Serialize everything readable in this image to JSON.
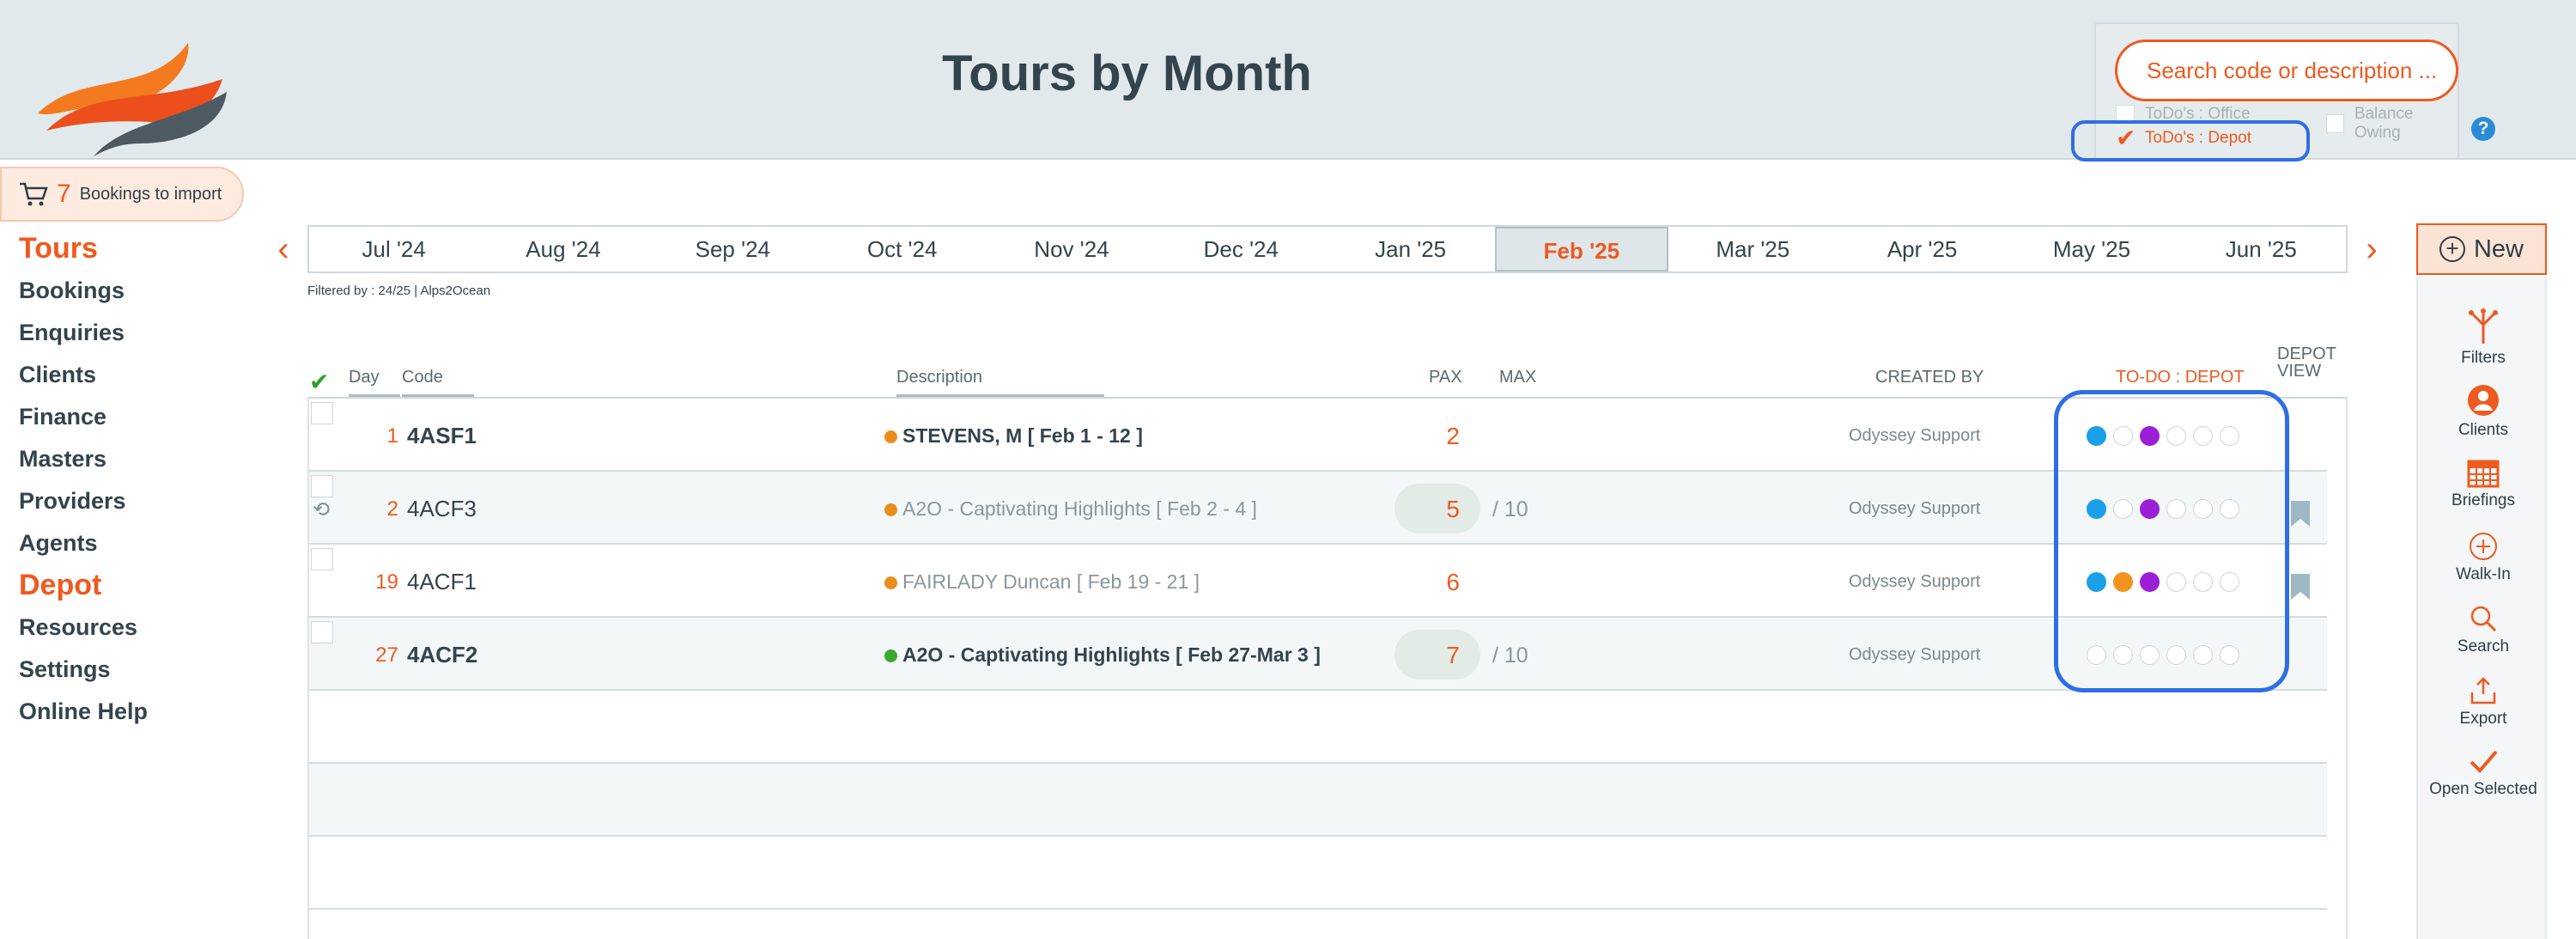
{
  "header": {
    "title": "Tours by Month"
  },
  "search": {
    "placeholder": "Search code or description ...",
    "todo_office_label": "ToDo's : Office",
    "balance_owing_label": "Balance Owing",
    "todo_depot_label": "ToDo's : Depot",
    "todo_depot_checked": true,
    "help": "?"
  },
  "import": {
    "count": "7",
    "label": "Bookings to import"
  },
  "sidebar": {
    "items": [
      {
        "label": "Tours",
        "section": true
      },
      {
        "label": "Bookings"
      },
      {
        "label": "Enquiries"
      },
      {
        "label": "Clients"
      },
      {
        "label": "Finance"
      },
      {
        "label": "Masters"
      },
      {
        "label": "Providers"
      },
      {
        "label": "Agents"
      },
      {
        "label": "Depot",
        "section": true
      },
      {
        "label": "Resources"
      },
      {
        "label": "Settings"
      },
      {
        "label": "Online Help"
      }
    ]
  },
  "months": {
    "tabs": [
      "Jul '24",
      "Aug '24",
      "Sep '24",
      "Oct '24",
      "Nov '24",
      "Dec '24",
      "Jan '25",
      "Feb '25",
      "Mar '25",
      "Apr '25",
      "May '25",
      "Jun '25"
    ],
    "active": "Feb '25",
    "prev_icon": "chevron-left-icon",
    "next_icon": "chevron-right-icon"
  },
  "filter_note": "Filtered by : 24/25 | Alps2Ocean",
  "table": {
    "headers": {
      "day": "Day",
      "code": "Code",
      "description": "Description",
      "pax": "PAX",
      "max": "MAX",
      "created_by": "CREATED BY",
      "todo": "TO-DO : DEPOT",
      "depot_view_1": "DEPOT",
      "depot_view_2": "VIEW"
    },
    "rows": [
      {
        "day": "1",
        "code": "4ASF1",
        "bold": true,
        "dot_color": "#e98d1c",
        "description": "STEVENS, M  [ Feb 1 - 12 ]",
        "pax": "2",
        "max": "",
        "created_by": "Odyssey Support",
        "todos": [
          "blue",
          "",
          "purple",
          "",
          "",
          ""
        ],
        "bookmark": false,
        "history": false
      },
      {
        "day": "2",
        "code": "4ACF3",
        "bold": false,
        "dot_color": "#e98d1c",
        "description": "A2O - Captivating Highlights  [ Feb 2 - 4 ]",
        "pax": "5",
        "max": "/ 10",
        "created_by": "Odyssey Support",
        "todos": [
          "blue",
          "",
          "purple",
          "",
          "",
          ""
        ],
        "bookmark": true,
        "history": true
      },
      {
        "day": "19",
        "code": "4ACF1",
        "bold": false,
        "dot_color": "#e98d1c",
        "description": "FAIRLADY Duncan  [ Feb 19 - 21 ]",
        "pax": "6",
        "max": "",
        "created_by": "Odyssey Support",
        "todos": [
          "blue",
          "orange",
          "purple",
          "",
          "",
          ""
        ],
        "bookmark": true,
        "history": false
      },
      {
        "day": "27",
        "code": "4ACF2",
        "bold": true,
        "dot_color": "#3aa832",
        "description": "A2O - Captivating Highlights  [ Feb 27-Mar 3 ]",
        "pax": "7",
        "max": "/ 10",
        "created_by": "Odyssey Support",
        "todos": [
          "",
          "",
          "",
          "",
          "",
          ""
        ],
        "bookmark": false,
        "history": false
      }
    ]
  },
  "toolbar": {
    "new_label": "New",
    "items": [
      {
        "label": "Filters",
        "icon": "filters-icon"
      },
      {
        "label": "Clients",
        "icon": "clients-icon"
      },
      {
        "label": "Briefings",
        "icon": "calendar-icon"
      },
      {
        "label": "Walk-In",
        "icon": "walk-in-icon"
      },
      {
        "label": "Search",
        "icon": "search-icon"
      },
      {
        "label": "Export",
        "icon": "export-icon"
      },
      {
        "label": "Open Selected",
        "icon": "checkmark-icon"
      }
    ]
  },
  "colors": {
    "accent": "#ee5a1f",
    "highlight": "#2e6ee6"
  }
}
